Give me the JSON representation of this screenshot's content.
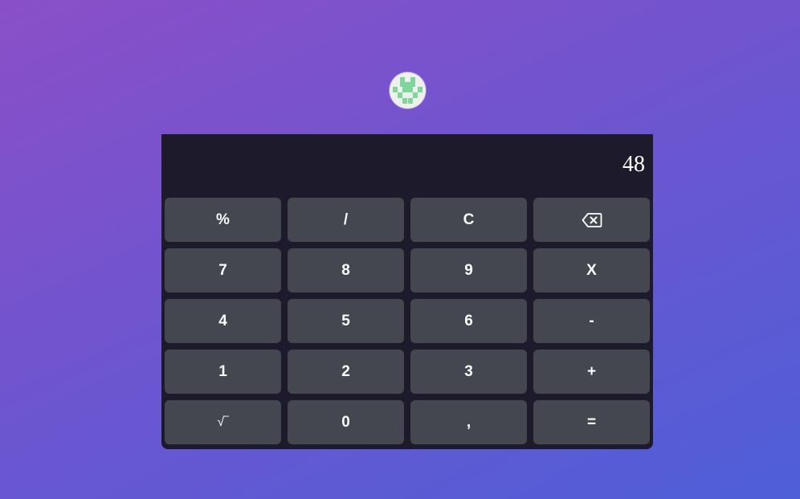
{
  "avatar": {
    "icon": "pixel-identicon",
    "color": "#7ed69a"
  },
  "display": {
    "value": "48"
  },
  "keypad": {
    "keys": [
      {
        "label": "%",
        "name": "percent-key"
      },
      {
        "label": "/",
        "name": "divide-key"
      },
      {
        "label": "C",
        "name": "clear-key"
      },
      {
        "label": "",
        "name": "backspace-key",
        "icon": "backspace-icon"
      },
      {
        "label": "7",
        "name": "digit-7-key"
      },
      {
        "label": "8",
        "name": "digit-8-key"
      },
      {
        "label": "9",
        "name": "digit-9-key"
      },
      {
        "label": "X",
        "name": "multiply-key"
      },
      {
        "label": "4",
        "name": "digit-4-key"
      },
      {
        "label": "5",
        "name": "digit-5-key"
      },
      {
        "label": "6",
        "name": "digit-6-key"
      },
      {
        "label": "-",
        "name": "subtract-key"
      },
      {
        "label": "1",
        "name": "digit-1-key"
      },
      {
        "label": "2",
        "name": "digit-2-key"
      },
      {
        "label": "3",
        "name": "digit-3-key"
      },
      {
        "label": "+",
        "name": "add-key"
      },
      {
        "label": "√‾",
        "name": "sqrt-key"
      },
      {
        "label": "0",
        "name": "digit-0-key"
      },
      {
        "label": ",",
        "name": "decimal-key"
      },
      {
        "label": "=",
        "name": "equals-key"
      }
    ]
  }
}
